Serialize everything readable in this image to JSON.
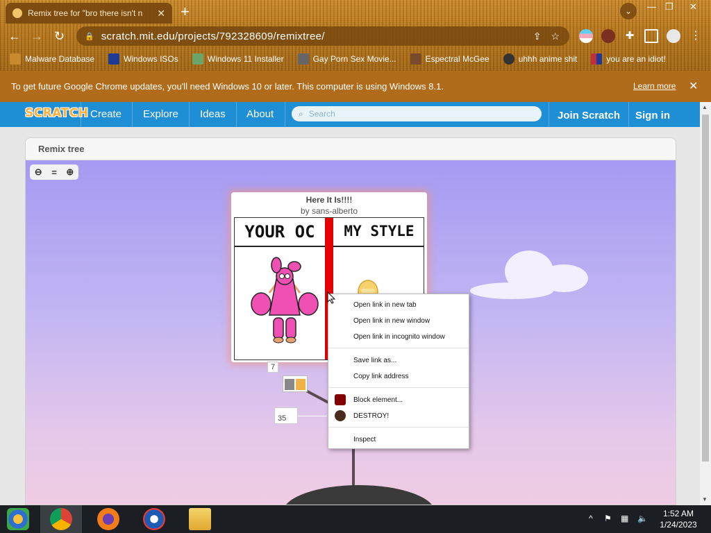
{
  "browser": {
    "tab_title": "Remix tree for \"bro there isn't n",
    "tab_close": "✕",
    "new_tab": "+",
    "url": "scratch.mit.edu/projects/792328609/remixtree/",
    "window_controls": {
      "minimize": "—",
      "maximize": "❐",
      "close": "✕"
    },
    "tab_search": "⌄",
    "nav": {
      "back": "←",
      "forward": "→",
      "reload": "↻"
    }
  },
  "bookmarks": [
    {
      "label": "Malware Database",
      "icon": "skull-icon",
      "color": "#c9892e"
    },
    {
      "label": "Windows ISOs",
      "icon": "x-icon",
      "color": "#1f3a93"
    },
    {
      "label": "Windows 11 Installer",
      "icon": "picture-icon",
      "color": "#6aa56a"
    },
    {
      "label": "Gay Porn Sex Movie...",
      "icon": "globe-icon",
      "color": "#666666"
    },
    {
      "label": "Espectral McGee",
      "icon": "avatar-icon",
      "color": "#7a4b2a"
    },
    {
      "label": "uhhh anime shit",
      "icon": "avatar-icon",
      "color": "#333333"
    },
    {
      "label": "you are an idiot!",
      "icon": "flag-icon",
      "color": "#c0303a"
    }
  ],
  "update_bar": {
    "message": "To get future Google Chrome updates, you'll need Windows 10 or later. This computer is using Windows 8.1.",
    "link": "Learn more",
    "close": "✕"
  },
  "scratch": {
    "logo": "SCRATCH",
    "nav": [
      "Create",
      "Explore",
      "Ideas",
      "About"
    ],
    "search_placeholder": "Search",
    "join": "Join Scratch",
    "signin": "Sign in"
  },
  "remix": {
    "heading": "Remix tree",
    "zoom": {
      "out": "⊖",
      "reset": "=",
      "in": "⊕"
    },
    "project_title": "Here It Is!!!!",
    "project_author": "by sans-alberto",
    "thumb_left": "YOUR OC",
    "thumb_right": "MY STYLE",
    "count_a": "7",
    "count_b": "35"
  },
  "context_menu": {
    "items": [
      "Open link in new tab",
      "Open link in new window",
      "Open link in incognito window",
      "Save link as...",
      "Copy link address",
      "Block element...",
      "DESTROY!",
      "Inspect"
    ]
  },
  "taskbar": {
    "time": "1:52 AM",
    "date": "1/24/2023",
    "tray_expand": "^"
  },
  "colors": {
    "scratch_blue": "#1e8fd5",
    "update_bar": "#b06b1b",
    "thumb_divider": "#e40000",
    "oc_pink": "#f04fb4"
  }
}
